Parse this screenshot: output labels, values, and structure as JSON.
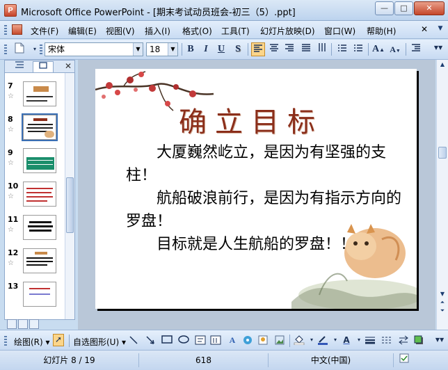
{
  "window": {
    "title": "Microsoft Office PowerPoint - [期末考试动员班会-初三（5）.ppt]",
    "app_icon_letter": "P",
    "minimize": "—",
    "maximize": "□",
    "close": "✕"
  },
  "menu": {
    "items": [
      "文件(F)",
      "编辑(E)",
      "视图(V)",
      "插入(I)",
      "格式(O)",
      "工具(T)",
      "幻灯片放映(D)",
      "窗口(W)",
      "帮助(H)"
    ],
    "close_doc": "✕"
  },
  "toolbar": {
    "font_name": "宋体",
    "font_size": "18",
    "bold": "B",
    "italic": "I",
    "underline": "U",
    "shadow": "S",
    "grow_font": "A",
    "shrink_font": "A"
  },
  "left_pane": {
    "close": "✕",
    "slides": [
      {
        "num": "7"
      },
      {
        "num": "8"
      },
      {
        "num": "9"
      },
      {
        "num": "10"
      },
      {
        "num": "11"
      },
      {
        "num": "12"
      },
      {
        "num": "13"
      }
    ]
  },
  "slide": {
    "title": "确立目标",
    "paragraphs": [
      "大厦巍然屹立，是因为有坚强的支柱！",
      "航船破浪前行，是因为有指示方向的罗盘！",
      "目标就是人生航船的罗盘！！"
    ]
  },
  "draw_toolbar": {
    "draw_menu": "绘图(R) ▾",
    "autoshapes_menu": "自选图形(U) ▾"
  },
  "status": {
    "slide_indicator": "幻灯片 8 / 19",
    "design": "618",
    "language": "中文(中国)"
  },
  "colors": {
    "title_red": "#8b2e1a",
    "selection_blue": "#3a6fb5",
    "office_bar": "#c7daf2"
  }
}
